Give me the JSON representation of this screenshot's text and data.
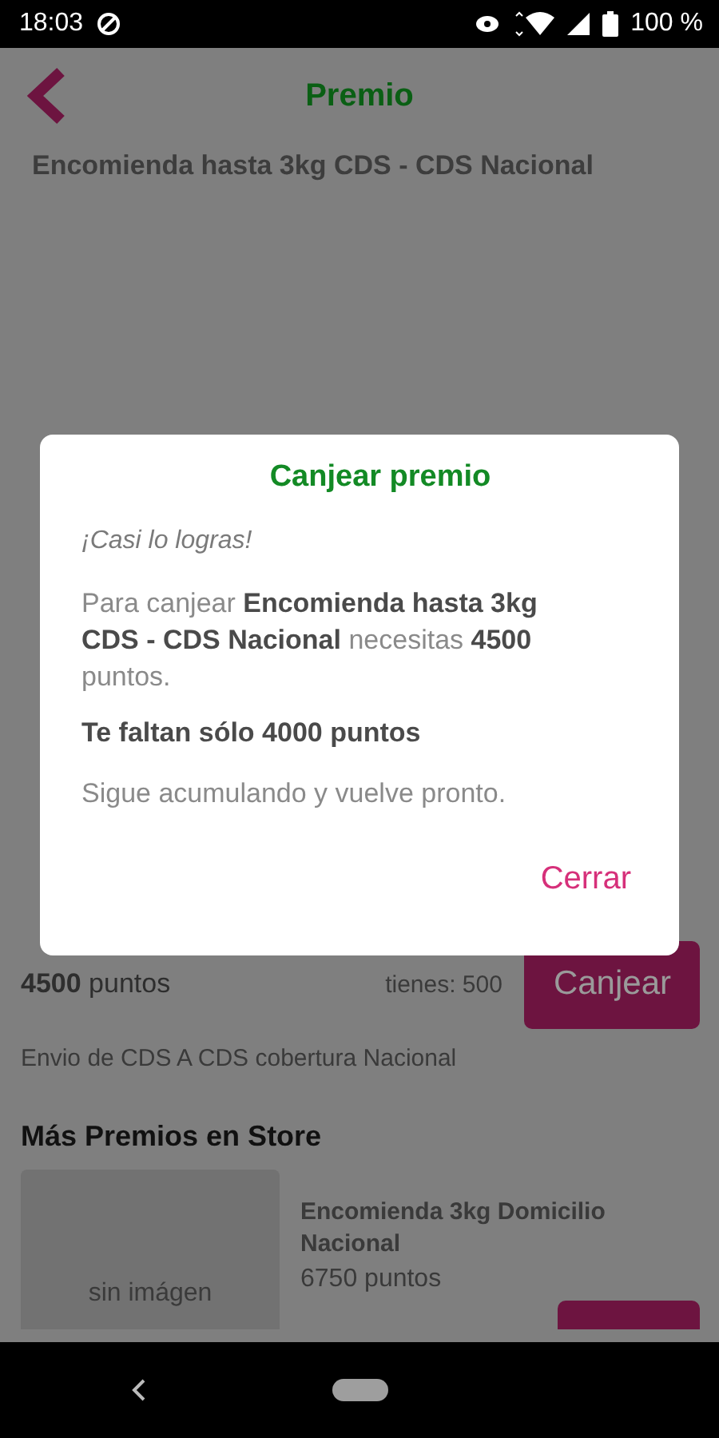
{
  "status_bar": {
    "time": "18:03",
    "battery": "100 %"
  },
  "header": {
    "title": "Premio"
  },
  "subtitle": "Encomienda hasta 3kg CDS - CDS Nacional",
  "reward": {
    "price": "**4500** puntos",
    "balance": "tienes: 500",
    "button": "Canjear",
    "description": "Envio de CDS A CDS cobertura Nacional"
  },
  "more": {
    "heading": "Más Premios en Store",
    "items": [
      {
        "image_text": "sin imágen",
        "name": "Encomienda 3kg Domicilio Nacional",
        "price": "6750 puntos"
      }
    ]
  },
  "dialog": {
    "title": "Canjear premio",
    "lead": "¡Casi lo logras!",
    "message": "Para canjear **Encomienda hasta 3kg CDS - CDS Nacional** necesitas **4500** puntos.",
    "missing": "Te faltan sólo 4000 puntos",
    "hint": "Sigue acumulando y vuelve pronto.",
    "close": "Cerrar"
  }
}
